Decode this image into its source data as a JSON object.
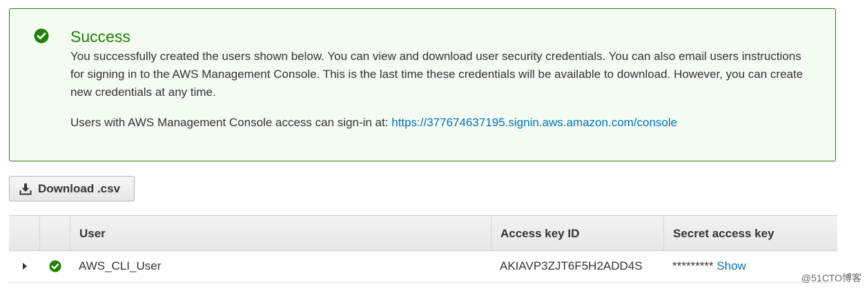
{
  "alert": {
    "title": "Success",
    "body": "You successfully created the users shown below. You can view and download user security credentials. You can also email users instructions for signing in to the AWS Management Console. This is the last time these credentials will be available to download. However, you can create new credentials at any time.",
    "signin_prefix": "Users with AWS Management Console access can sign-in at: ",
    "signin_url": "https://377674637195.signin.aws.amazon.com/console",
    "color": "#1d8102"
  },
  "toolbar": {
    "download_label": "Download .csv"
  },
  "table": {
    "columns": [
      "User",
      "Access key ID",
      "Secret access key"
    ],
    "rows": [
      {
        "user": "AWS_CLI_User",
        "access_key_id": "AKIAVP3ZJT6F5H2ADD4S",
        "secret_masked": "*********",
        "show_label": "Show"
      }
    ]
  },
  "watermark": "@51CTO博客",
  "colors": {
    "link": "#0073bb",
    "success": "#1d8102"
  }
}
